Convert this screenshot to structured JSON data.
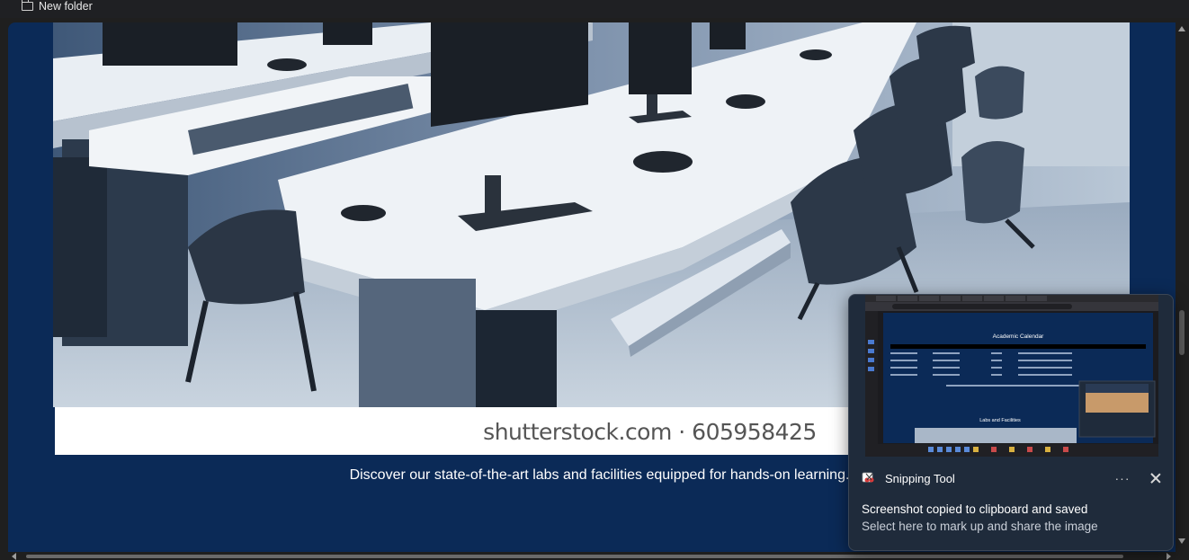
{
  "bookmarks_bar": {
    "items": [
      {
        "label": "New folder",
        "icon": "folder-icon"
      }
    ]
  },
  "page": {
    "background_color": "#0b2a57",
    "lab_image": {
      "watermark": "shutterstock.com · 605958425"
    },
    "caption": "Discover our state-of-the-art labs and facilities equipped for hands-on learning."
  },
  "notification": {
    "app_name": "Snipping Tool",
    "app_icon": "snipping-tool-icon",
    "more_label": "···",
    "close_icon": "close-icon",
    "message": "Screenshot copied to clipboard and saved",
    "sub_message": "Select here to mark up and share the image",
    "preview": {
      "title": "Academic Calendar",
      "section_heading": "Labs and Facilities"
    }
  }
}
